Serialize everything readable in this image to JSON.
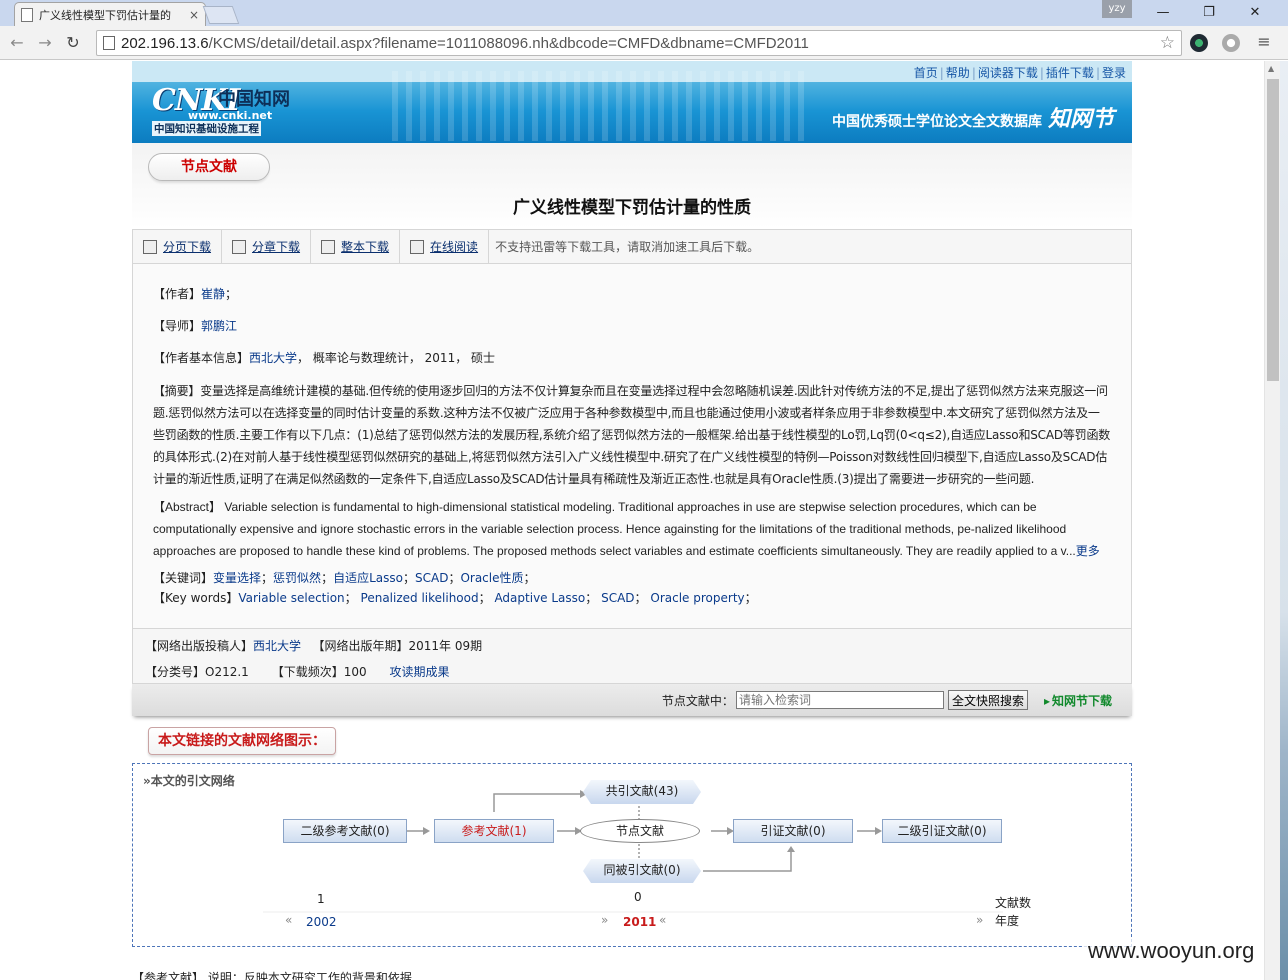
{
  "browser": {
    "tab_title": "广义线性模型下罚估计量的",
    "tab_close": "×",
    "user_badge": "yzy",
    "url_host": "202.196.13.6",
    "url_path": "/KCMS/detail/detail.aspx?filename=1011088096.nh&dbcode=CMFD&dbname=CMFD2011",
    "min": "—",
    "max": "❐",
    "close": "✕"
  },
  "header": {
    "links": [
      "首页",
      "帮助",
      "阅读器下载",
      "插件下载",
      "登录"
    ],
    "logo_latin": "CNKI",
    "logo_cn": "中国知网",
    "logo_www": "www.cnki.net",
    "logo_project": "中国知识基础设施工程",
    "db_name": "中国优秀硕士学位论文全文数据库",
    "db_mark": "知网节"
  },
  "node_badge": "节点文献",
  "title": "广义线性模型下罚估计量的性质",
  "download": {
    "items": [
      "分页下载",
      "分章下载",
      "整本下载",
      "在线阅读"
    ],
    "note": "不支持迅雷等下载工具，请取消加速工具后下载。"
  },
  "meta": {
    "author_label": "【作者】",
    "author": "崔静",
    "author_sep": "；",
    "advisor_label": "【导师】",
    "advisor": "郭鹏江",
    "info_label": "【作者基本信息】",
    "info_school": "西北大学",
    "info_rest": "， 概率论与数理统计， 2011， 硕士",
    "abstract_label": "【摘要】",
    "abstract": "变量选择是高维统计建模的基础.但传统的使用逐步回归的方法不仅计算复杂而且在变量选择过程中会忽略随机误差.因此针对传统方法的不足,提出了惩罚似然方法来克服这一问题.惩罚似然方法可以在选择变量的同时估计变量的系数.这种方法不仅被广泛应用于各种参数模型中,而且也能通过使用小波或者样条应用于非参数模型中.本文研究了惩罚似然方法及一些罚函数的性质.主要工作有以下几点：(1)总结了惩罚似然方法的发展历程,系统介绍了惩罚似然方法的一般框架.给出基于线性模型的Lo罚,Lq罚(0<q≤2),自适应Lasso和SCAD等罚函数的具体形式.(2)在对前人基于线性模型惩罚似然研究的基础上,将惩罚似然方法引入广义线性模型中.研究了在广义线性模型的特例—Poisson对数线性回归模型下,自适应Lasso及SCAD估计量的渐近性质,证明了在满足似然函数的一定条件下,自适应Lasso及SCAD估计量具有稀疏性及渐近正态性.也就是具有Oracle性质.(3)提出了需要进一步研究的一些问题.",
    "abstract_en_label": "【Abstract】",
    "abstract_en": "Variable selection is fundamental to high-dimensional statistical modeling. Traditional approaches in use are stepwise selection procedures, which can be computationally expensive and ignore stochastic errors in the variable selection process. Hence againsting for the limitations of the traditional methods, pe-nalized likelihood approaches are proposed to handle these kind of problems. The proposed methods select variables and estimate coefficients simultaneously. They are readily applied to a v...",
    "more": "更多",
    "kw_label": "【关键词】",
    "keywords": [
      "变量选择",
      "惩罚似然",
      "自适应Lasso",
      "SCAD",
      "Oracle性质"
    ],
    "kw_en_label": "【Key words】",
    "keywords_en": [
      "Variable selection",
      "Penalized likelihood",
      "Adaptive Lasso",
      "SCAD",
      "Oracle property"
    ],
    "kw_sep": "；"
  },
  "pub": {
    "contrib_label": "【网络出版投稿人】",
    "contrib": "西北大学",
    "date_label": "【网络出版年期】",
    "date": "2011年 09期",
    "class_label": "【分类号】",
    "class": "O212.1",
    "freq_label": "【下载频次】",
    "freq": "100",
    "attack": "攻读期成果"
  },
  "search": {
    "label": "节点文献中：",
    "placeholder": "请输入检索词",
    "button": "全文快照搜索",
    "download": "知网节下载"
  },
  "network": {
    "badge": "本文链接的文献网络图示：",
    "caption": "»本文的引文网络",
    "nodes": {
      "ref2": "二级参考文献(0)",
      "ref": "参考文献(1)",
      "node": "节点文献",
      "cite": "引证文献(0)",
      "cite2": "二级引证文献(0)",
      "cocite": "共引文献(43)",
      "cocited": "同被引文献(0)"
    },
    "timeline": {
      "left_count": "1",
      "left_year": "2002",
      "mid_count": "0",
      "mid_year": "2011",
      "right_count_label": "文献数",
      "right_year_label": "年度",
      "prev": "«",
      "next": "»"
    }
  },
  "ref_label": "【参考文献】 说明：反映本文研究工作的背景和依据",
  "watermark": "www.wooyun.org"
}
